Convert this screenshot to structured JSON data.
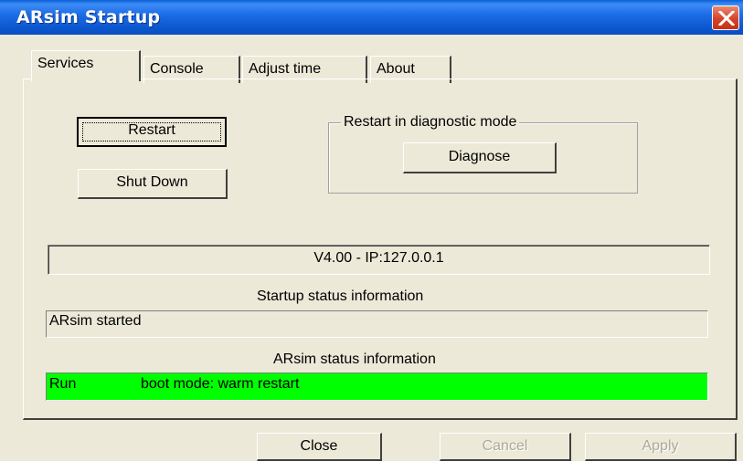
{
  "window": {
    "title": "ARsim Startup"
  },
  "tabs": [
    {
      "label": "Services"
    },
    {
      "label": "Console"
    },
    {
      "label": "Adjust time"
    },
    {
      "label": "About"
    }
  ],
  "services": {
    "restart_label": "Restart",
    "shutdown_label": "Shut Down",
    "diagnostic_group_label": "Restart in diagnostic mode",
    "diagnose_label": "Diagnose",
    "version_text": "V4.00 - IP:127.0.0.1",
    "startup_status_label": "Startup status information",
    "startup_status_value": "ARsim started",
    "arsim_status_label": "ARsim status information",
    "arsim_state": "Run",
    "arsim_boot_mode": "boot mode: warm restart"
  },
  "footer": {
    "close_label": "Close",
    "cancel_label": "Cancel",
    "apply_label": "Apply"
  },
  "colors": {
    "status_ok": "#00ff00",
    "titlebar": "#0a57cf",
    "dialog_bg": "#ece9d8"
  },
  "icons": {
    "close": "close-x-icon"
  }
}
